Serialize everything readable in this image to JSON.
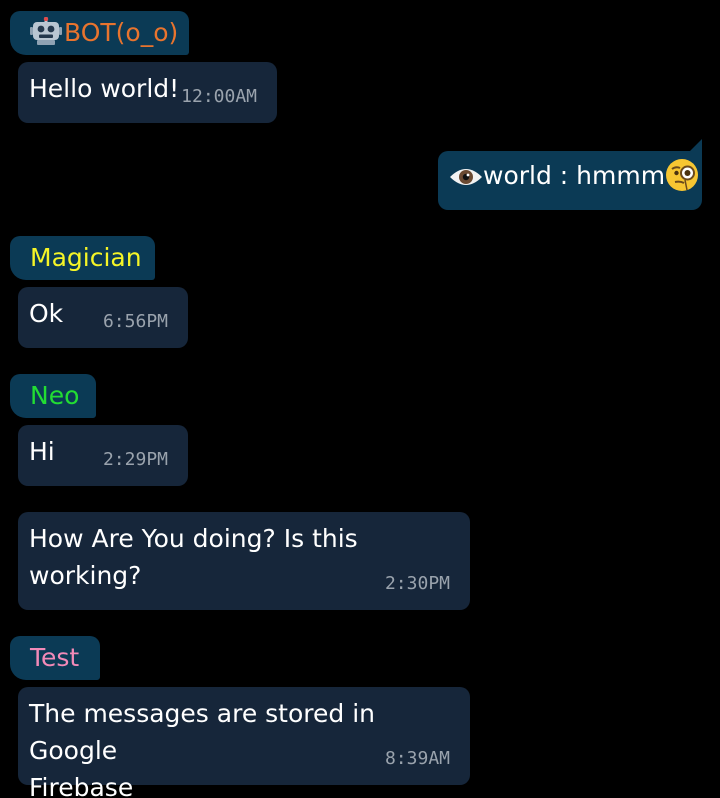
{
  "messages": [
    {
      "sender": "BOT(o_o)",
      "sender_color": "#e8742e",
      "sender_icon": "robot-icon",
      "text": "Hello world!",
      "time": "12:00AM"
    },
    {
      "sender": "Magician",
      "sender_color": "#f5f527",
      "text": "Ok",
      "time": "6:56PM"
    },
    {
      "sender": "Neo",
      "sender_color": "#22dd33",
      "text": "Hi",
      "time": "2:29PM"
    },
    {
      "sender": "Neo",
      "text": "How Are You doing? Is this\nworking?",
      "time": "2:30PM"
    },
    {
      "sender": "Test",
      "sender_color": "#f28ab8",
      "text": "The messages are stored in Google\nFirebase",
      "time": "8:39AM"
    }
  ],
  "own_message": {
    "text": "world : hmmm",
    "leading_icon": "eye-icon",
    "trailing_icon": "monocle-face-icon"
  },
  "colors": {
    "background": "#000000",
    "bubble": "#16263a",
    "tag": "#0b3a55",
    "time_text": "#9aa3ad"
  }
}
